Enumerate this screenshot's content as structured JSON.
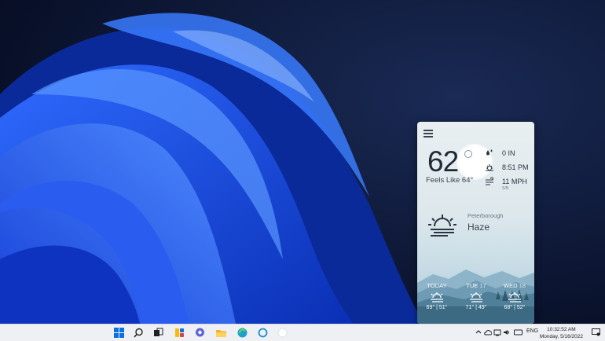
{
  "widget": {
    "temperature": "62",
    "feels_like": "Feels Like 64°",
    "stats": [
      {
        "icon": "raindrop-icon",
        "text": "0 IN"
      },
      {
        "icon": "sunset-icon",
        "text": "8:51 PM"
      },
      {
        "icon": "wind-icon",
        "text": "11 MPH"
      }
    ],
    "wind_dir": "S/N",
    "location": "Peterborough",
    "condition": "Haze",
    "forecast": [
      {
        "day": "TODAY",
        "date": "",
        "hilo": "69° | 51°"
      },
      {
        "day": "TUE",
        "date": "17",
        "hilo": "71° | 49°"
      },
      {
        "day": "WED",
        "date": "18",
        "hilo": "68° | 52°"
      }
    ]
  },
  "taskbar": {
    "icons": [
      "windows-start-icon",
      "search-icon",
      "task-view-icon",
      "widgets-icon",
      "chat-icon",
      "file-explorer-icon",
      "edge-icon",
      "cortana-icon",
      "weather-app-icon"
    ],
    "language": "ENG",
    "time": "10:32:52 AM",
    "date": "Monday, 5/16/2022"
  },
  "colors": {
    "accent": "#1e5bff",
    "taskbar": "#eef0f3"
  }
}
